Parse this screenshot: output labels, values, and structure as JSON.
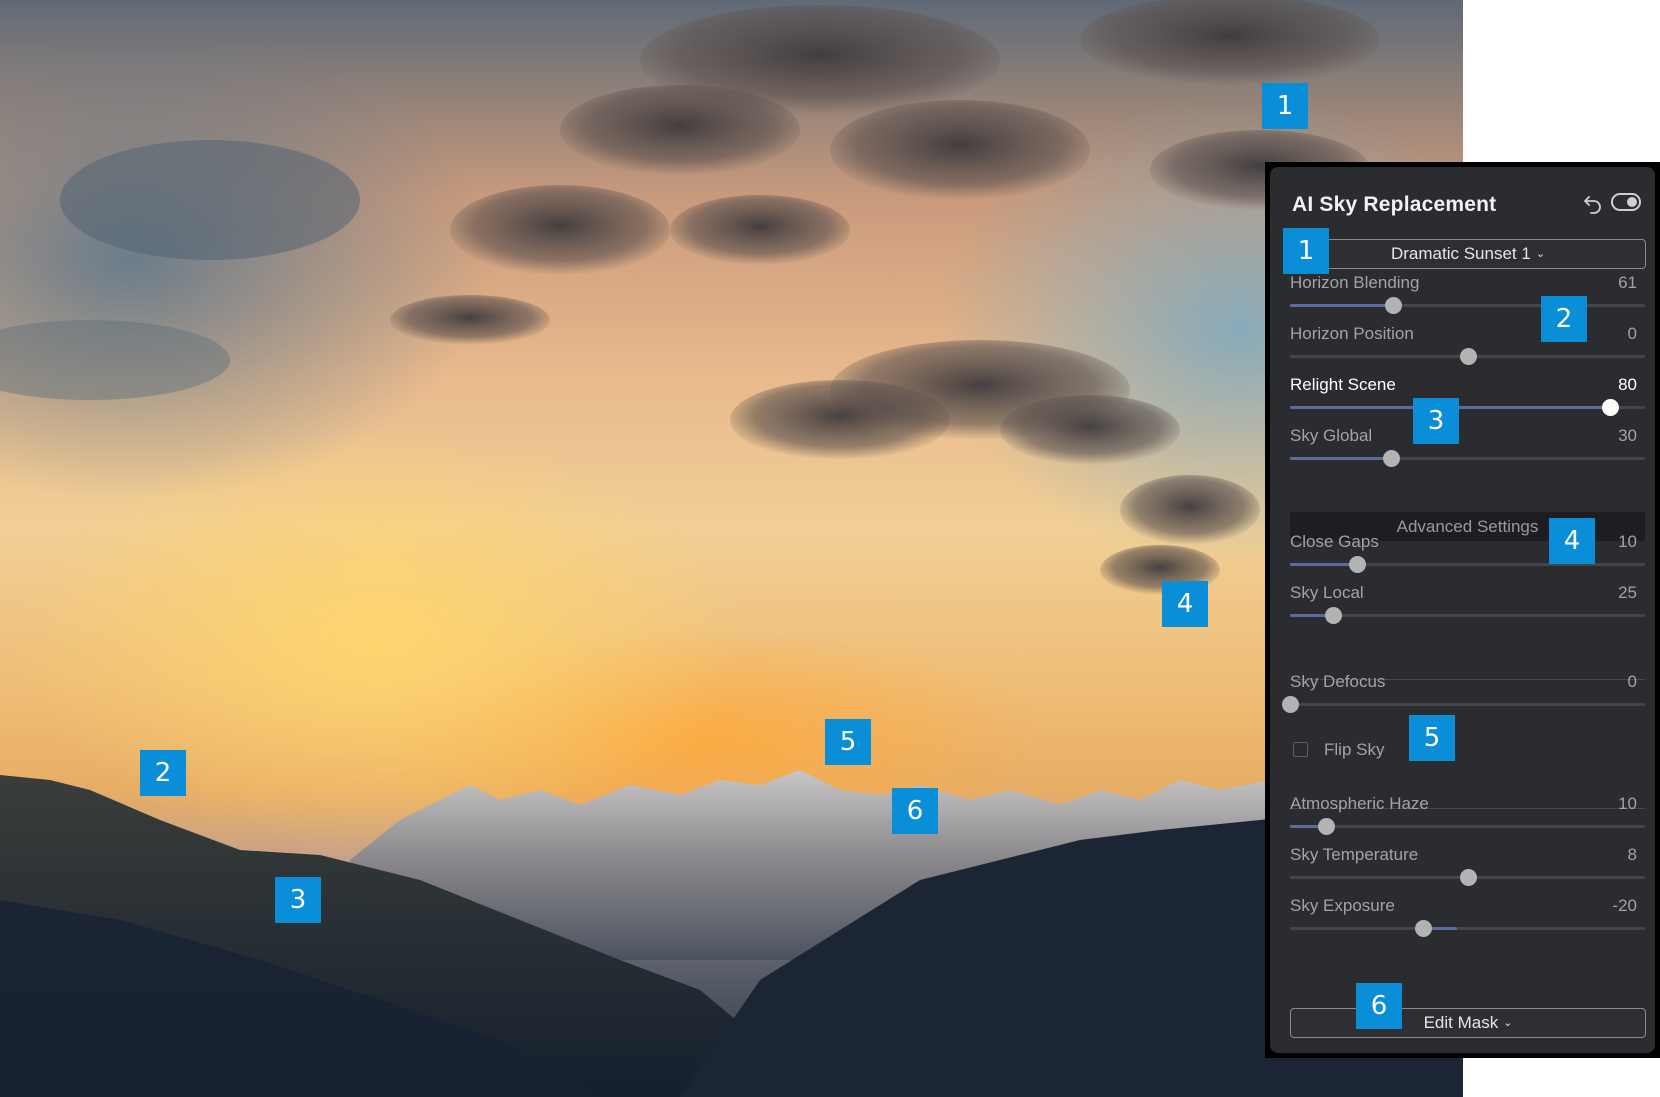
{
  "panel": {
    "title": "AI Sky Replacement",
    "sky_preset": "Dramatic Sunset 1",
    "sliders": [
      {
        "label": "Horizon Blending",
        "value": "61",
        "pos": 0.29,
        "fill_from": 0,
        "active": false
      },
      {
        "label": "Horizon Position",
        "value": "0",
        "pos": 0.5,
        "fill_from": 0.5,
        "active": false
      },
      {
        "label": "Relight Scene",
        "value": "80",
        "pos": 0.9,
        "fill_from": 0,
        "active": true
      },
      {
        "label": "Sky Global",
        "value": "30",
        "pos": 0.285,
        "fill_from": 0,
        "active": false
      }
    ],
    "advanced_label": "Advanced Settings",
    "advanced_sliders": [
      {
        "label": "Close Gaps",
        "value": "10",
        "pos": 0.19,
        "fill_from": 0,
        "active": false
      },
      {
        "label": "Sky Local",
        "value": "25",
        "pos": 0.12,
        "fill_from": 0,
        "active": false
      }
    ],
    "defocus": {
      "label": "Sky Defocus",
      "value": "0",
      "pos": 0.0,
      "fill_from": 0,
      "active": false
    },
    "flip_sky": {
      "label": "Flip Sky",
      "checked": false
    },
    "lower_sliders": [
      {
        "label": "Atmospheric Haze",
        "value": "10",
        "pos": 0.1,
        "fill_from": 0,
        "active": false
      },
      {
        "label": "Sky Temperature",
        "value": "8",
        "pos": 0.5,
        "fill_from": 0.5,
        "active": false
      },
      {
        "label": "Sky Exposure",
        "value": "-20",
        "pos": 0.375,
        "fill_from": 0.375,
        "fill_to": 0.47,
        "active": false
      }
    ],
    "edit_mask_label": "Edit Mask"
  },
  "callouts": {
    "photo": [
      "1",
      "2",
      "3",
      "4",
      "5",
      "6"
    ],
    "panel": [
      "1",
      "2",
      "3",
      "4",
      "5",
      "6"
    ]
  },
  "colors": {
    "callout": "#0a8ed8",
    "panel_bg": "#2b2c30",
    "slider_fill": "#5c6b9e"
  }
}
